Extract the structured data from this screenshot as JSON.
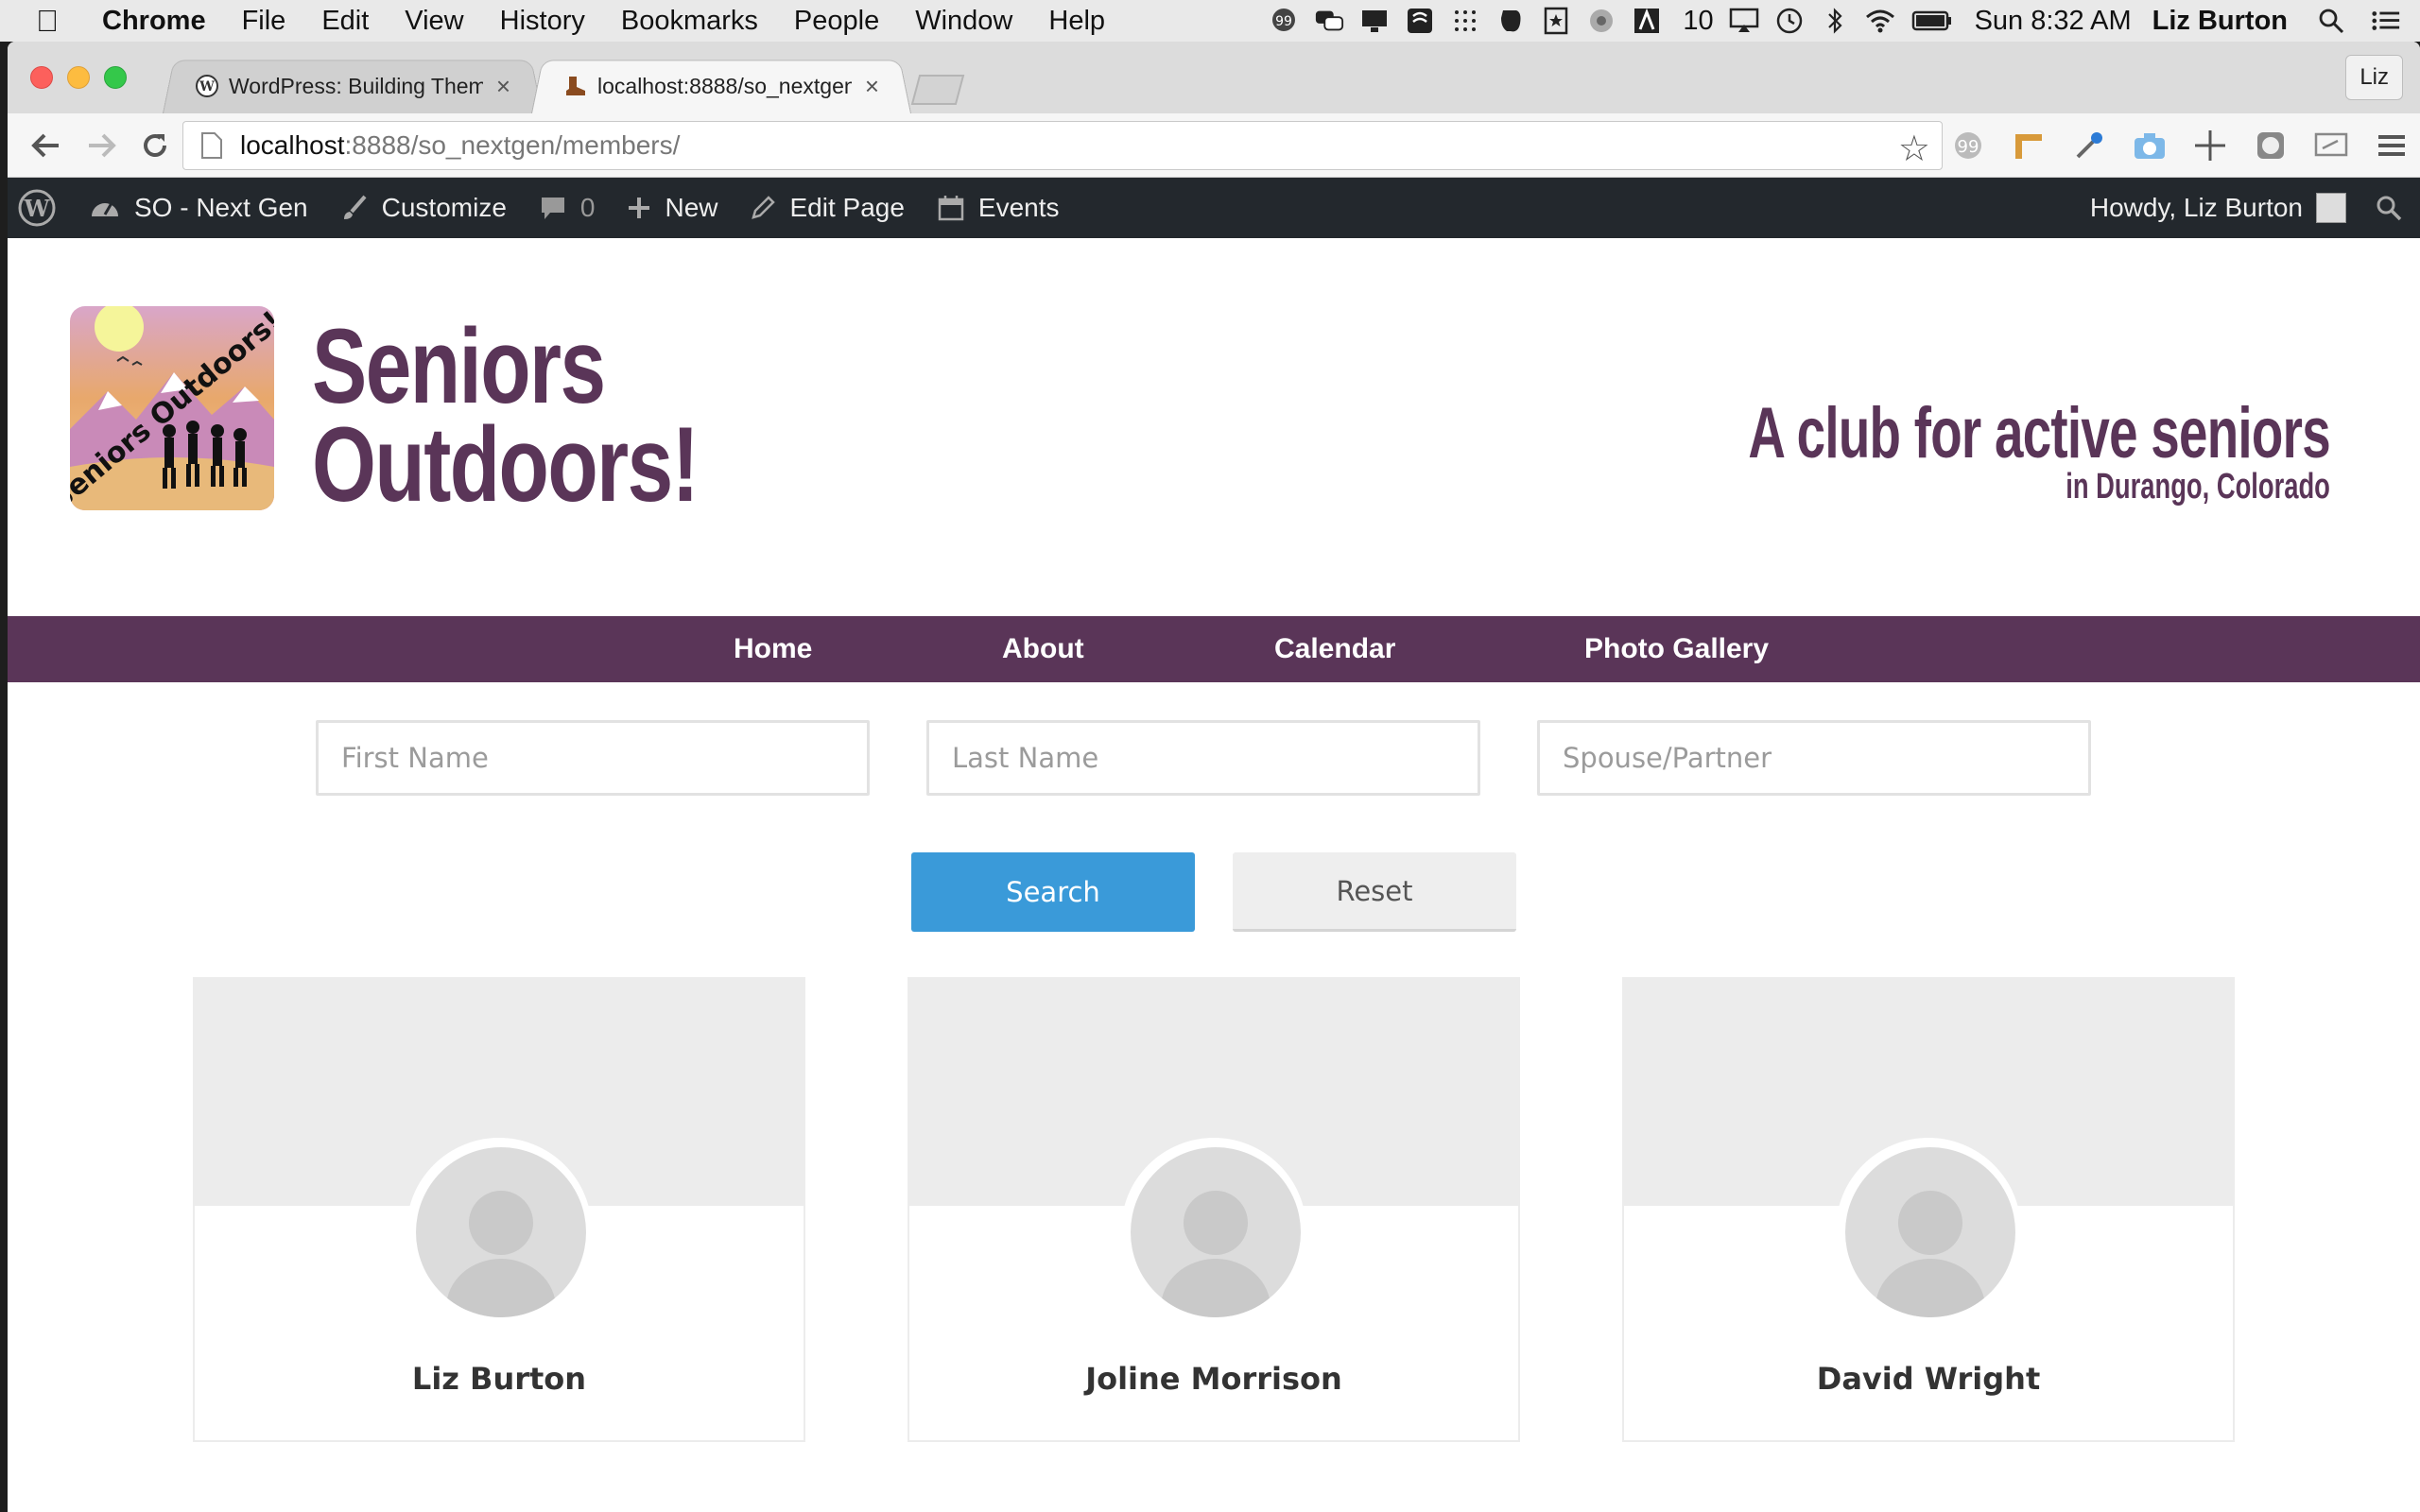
{
  "menubar": {
    "app": "Chrome",
    "items": [
      "File",
      "Edit",
      "View",
      "History",
      "Bookmarks",
      "People",
      "Window",
      "Help"
    ],
    "tray_badge": "10",
    "clock": "Sun 8:32 AM",
    "user": "Liz Burton"
  },
  "browser": {
    "tabs": [
      {
        "title": "WordPress: Building Theme"
      },
      {
        "title": "localhost:8888/so_nextgen"
      }
    ],
    "profile": "Liz",
    "url_host": "localhost",
    "url_rest": ":8888/so_nextgen/members/"
  },
  "adminbar": {
    "site": "SO - Next Gen",
    "customize": "Customize",
    "comments": "0",
    "new": "New",
    "edit": "Edit Page",
    "events": "Events",
    "howdy": "Howdy, Liz Burton"
  },
  "site": {
    "title_line1": "Seniors",
    "title_line2": "Outdoors!",
    "tagline": "A club for active seniors",
    "subtagline": "in Durango, Colorado",
    "logo_text": "Seniors Outdoors!",
    "brand_color": "#5a3558"
  },
  "nav": [
    "Home",
    "About",
    "Calendar",
    "Photo Gallery"
  ],
  "search": {
    "first_placeholder": "First Name",
    "last_placeholder": "Last Name",
    "spouse_placeholder": "Spouse/Partner",
    "search_label": "Search",
    "reset_label": "Reset",
    "search_color": "#3a9ad9"
  },
  "members": [
    {
      "name": "Liz Burton"
    },
    {
      "name": "Joline Morrison"
    },
    {
      "name": "David Wright"
    }
  ]
}
